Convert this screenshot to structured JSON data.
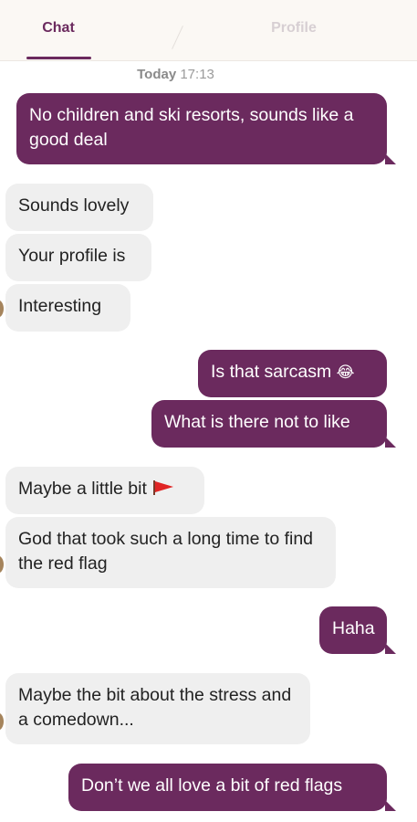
{
  "tabs": {
    "chat_label": "Chat",
    "profile_label": "Profile"
  },
  "timestamp": {
    "day": "Today",
    "time": "17:13"
  },
  "messages": [
    {
      "side": "sent",
      "text": "No children and ski resorts, sounds like a good deal"
    },
    {
      "side": "received",
      "text": "Sounds lovely"
    },
    {
      "side": "received",
      "text": "Your profile is"
    },
    {
      "side": "received",
      "text": "Interesting"
    },
    {
      "side": "sent",
      "text": "Is that sarcasm",
      "emoji": "😂"
    },
    {
      "side": "sent",
      "text": "What is there not to like"
    },
    {
      "side": "received",
      "text": "Maybe a little bit",
      "icon": "red-flag-icon"
    },
    {
      "side": "received",
      "text": "God that took such a long time to find the red flag"
    },
    {
      "side": "sent",
      "text": "Haha"
    },
    {
      "side": "received",
      "text": "Maybe the bit about the stress and a comedown..."
    },
    {
      "side": "sent",
      "text": "Don’t we all love a bit of red flags"
    }
  ],
  "colors": {
    "accent": "#6b2a5e",
    "received_bubble": "#efefef",
    "header_bg": "#fbf8f4",
    "inactive_tab": "#d7cfd3"
  }
}
